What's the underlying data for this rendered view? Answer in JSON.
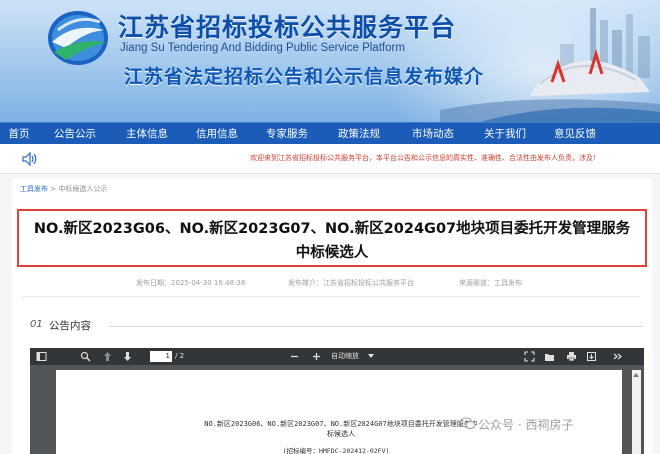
{
  "header": {
    "title": "江苏省招标投标公共服务平台",
    "subtitle": "Jiang Su Tendering And Bidding Public Service Platform",
    "slogan": "江苏省法定招标公告和公示信息发布媒介"
  },
  "nav": {
    "items": [
      "首页",
      "公告公示",
      "主体信息",
      "信用信息",
      "专家服务",
      "政策法规",
      "市场动态",
      "关于我们",
      "意见反馈"
    ]
  },
  "notice": {
    "text": "欢迎来到江苏省招标投标公共服务平台，本平台公告和公示信息的真实性、准确性、合法性由发布人负责，涉及!"
  },
  "breadcrumb": {
    "root": "工具发布",
    "separator": " > ",
    "current": "中标候选人公示"
  },
  "article": {
    "title_line1": "NO.新区2023G06、NO.新区2023G07、NO.新区2024G07地块项目委托开发管理服务",
    "title_line2": "中标候选人",
    "meta": {
      "date_label": "发布日期：",
      "date_value": "2025-04-30 16:48:38",
      "platform_label": "发布媒介：",
      "platform_value": "江苏省招标投标公共服务平台",
      "source_label": "来源渠道：",
      "source_value": "工具发布"
    }
  },
  "section": {
    "number": "01",
    "label": "公告内容"
  },
  "pdf_viewer": {
    "current_page": "1",
    "total_pages": "/ 2",
    "zoom": "自动缩放",
    "doc_title_line1": "NO.新区2023G06、NO.新区2023G07、NO.新区2024G07地块项目委托开发管理服务中",
    "doc_title_line2": "标候选人",
    "doc_code": "(招标编号：HMFDC-202412-02FV)"
  },
  "watermark": {
    "text": "公众号 · 西祠房子"
  },
  "colors": {
    "nav_bg": "#1a5cb8",
    "title_blue": "#0d4fa8",
    "highlight_border": "#e0423a",
    "notice_red": "#d43a2f"
  }
}
